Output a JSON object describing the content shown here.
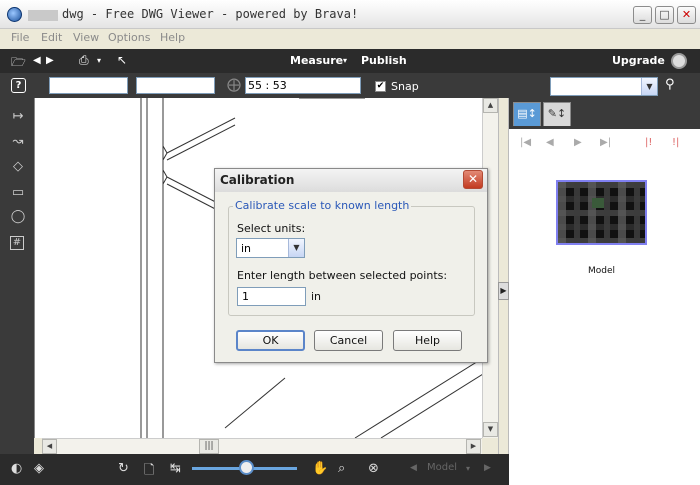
{
  "window": {
    "title": "dwg - Free DWG Viewer - powered by Brava!",
    "controls": {
      "minimize": "_",
      "maximize": "□",
      "close": "✕"
    }
  },
  "menu": [
    "File",
    "Edit",
    "View",
    "Options",
    "Help"
  ],
  "toolbar": {
    "measure_label": "Measure",
    "measure_arrow": "▾",
    "publish_label": "Publish",
    "upgrade_label": "Upgrade"
  },
  "coordbar": {
    "help_label": "?",
    "field1": "",
    "field2": "",
    "coords": "55 : 53",
    "snap_label": "Snap",
    "snap_checked": true,
    "search_value": ""
  },
  "bottom": {
    "model_label": "Model",
    "zoom_fraction": 0.52
  },
  "panel": {
    "tabs": [
      "pages-tab",
      "markup-tab"
    ],
    "thumbnail_label": "Model"
  },
  "dialog": {
    "title": "Calibration",
    "group_label": "Calibrate scale to known length",
    "units_label": "Select units:",
    "units_value": "in",
    "length_label": "Enter length between selected points:",
    "length_value": "1",
    "length_unit": "in",
    "ok_label": "OK",
    "cancel_label": "Cancel",
    "help_label": "Help"
  },
  "colors": {
    "toolbar_dark": "#2b2b2b",
    "accent_blue": "#2a58b8",
    "close_red": "#c23a20"
  }
}
